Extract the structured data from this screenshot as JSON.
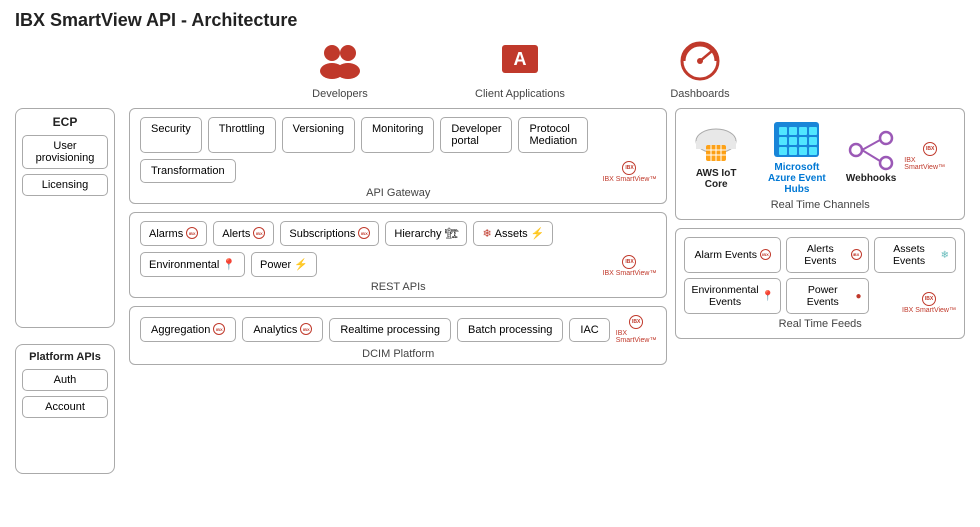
{
  "title": "IBX SmartView API - Architecture",
  "top_icons": [
    {
      "id": "developers",
      "label": "Developers",
      "icon": "developers"
    },
    {
      "id": "client-apps",
      "label": "Client Applications",
      "icon": "client-apps"
    },
    {
      "id": "dashboards",
      "label": "Dashboards",
      "icon": "dashboards"
    }
  ],
  "ecp": {
    "title": "ECP",
    "items": [
      {
        "label": "User provisioning"
      },
      {
        "label": "Licensing"
      }
    ]
  },
  "platform_apis": {
    "title": "Platform APIs",
    "items": [
      {
        "label": "Auth"
      },
      {
        "label": "Account"
      }
    ]
  },
  "api_gateway": {
    "label": "API Gateway",
    "items": [
      {
        "label": "Security"
      },
      {
        "label": "Throttling"
      },
      {
        "label": "Versioning"
      },
      {
        "label": "Monitoring"
      },
      {
        "label": "Developer portal"
      },
      {
        "label": "Protocol Mediation"
      },
      {
        "label": "Transformation"
      }
    ]
  },
  "rest_apis": {
    "label": "REST APIs",
    "items": [
      {
        "label": "Alarms",
        "icon": "📊"
      },
      {
        "label": "Alerts",
        "icon": "🔔"
      },
      {
        "label": "Subscriptions",
        "icon": "📋"
      },
      {
        "label": "Hierarchy",
        "icon": "🏗"
      },
      {
        "label": "Assets",
        "icon": "⚡"
      },
      {
        "label": "Environmental",
        "icon": "🌡"
      },
      {
        "label": "Power",
        "icon": "⚡"
      }
    ]
  },
  "dcim": {
    "label": "DCIM Platform",
    "items": [
      {
        "label": "Aggregation",
        "icon": "🔴"
      },
      {
        "label": "Analytics",
        "icon": "🔴"
      },
      {
        "label": "Realtime processing"
      },
      {
        "label": "Batch processing"
      },
      {
        "label": "IAC"
      }
    ]
  },
  "real_time_channels": {
    "label": "Real Time Channels",
    "items": [
      {
        "label": "AWS IoT Core",
        "color": "orange"
      },
      {
        "label": "Microsoft\nAzure Event Hubs",
        "color": "blue"
      },
      {
        "label": "Webhooks",
        "color": "purple"
      }
    ]
  },
  "real_time_feeds": {
    "label": "Real Time Feeds",
    "items": [
      {
        "label": "Alarm Events",
        "icon": "📊"
      },
      {
        "label": "Alerts Events",
        "icon": "🔔"
      },
      {
        "label": "Assets Events",
        "icon": "❄"
      },
      {
        "label": "Environmental Events",
        "icon": "📍"
      },
      {
        "label": "Power Events",
        "icon": "🔴"
      }
    ]
  }
}
